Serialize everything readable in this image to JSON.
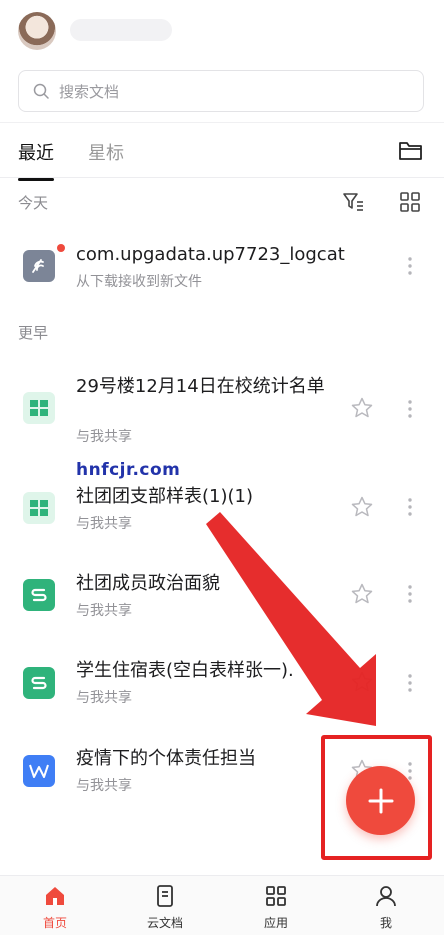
{
  "search": {
    "placeholder": "搜索文档"
  },
  "tabs": [
    {
      "label": "最近"
    },
    {
      "label": "星标"
    }
  ],
  "sections": {
    "today": "今天",
    "earlier": "更早"
  },
  "files": [
    {
      "title": "com.upgadata.up7723_logcat",
      "subtitle": "从下载接收到新文件",
      "type": "unknown",
      "color": "#7c8597",
      "new_badge": true,
      "starred": null
    },
    {
      "title": "29号楼12月14日在校统计名单",
      "subtitle": "与我共享",
      "type": "sheet",
      "color": "#2fb37b",
      "starred": false
    },
    {
      "title": "社团团支部样表(1)(1)",
      "subtitle": "与我共享",
      "type": "sheet",
      "color": "#2fb37b",
      "starred": false
    },
    {
      "title": "社团成员政治面貌",
      "subtitle": "与我共享",
      "type": "s-doc",
      "color": "#2fb37b",
      "starred": false
    },
    {
      "title": "学生住宿表(空白表样张一).",
      "subtitle": "与我共享",
      "type": "s-doc",
      "color": "#2fb37b",
      "starred": false
    },
    {
      "title": "疫情下的个体责任担当",
      "subtitle": "与我共享",
      "type": "w-doc",
      "color": "#3f7ef5",
      "starred": false
    }
  ],
  "watermark": "hnfcjr.com",
  "bottom_nav": [
    {
      "label": "首页",
      "icon": "home-icon",
      "active": true
    },
    {
      "label": "云文档",
      "icon": "document-icon",
      "active": false
    },
    {
      "label": "应用",
      "icon": "apps-grid-icon",
      "active": false
    },
    {
      "label": "我",
      "icon": "person-icon",
      "active": false
    }
  ],
  "colors": {
    "accent": "#ef4a3d",
    "annotation": "#e52222",
    "sheet": "#2fb37b",
    "word": "#3f7ef5"
  }
}
